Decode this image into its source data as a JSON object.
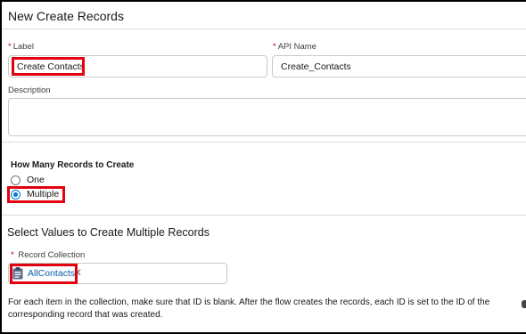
{
  "header": {
    "title": "New Create Records"
  },
  "label_field": {
    "label": "Label",
    "required_mark": "*",
    "value": "Create Contacts"
  },
  "api_field": {
    "label": "API Name",
    "required_mark": "*",
    "value": "Create_Contacts"
  },
  "description_field": {
    "label": "Description",
    "value": ""
  },
  "how_many": {
    "heading": "How Many Records to Create",
    "options": [
      {
        "label": "One",
        "selected": false
      },
      {
        "label": "Multiple",
        "selected": true
      }
    ]
  },
  "select_values": {
    "title": "Select Values to Create Multiple Records",
    "collection_label": "Record Collection",
    "required_mark": "*",
    "collection_value": "AllContacts",
    "clear_glyph": "✕"
  },
  "help_text": "For each item in the collection, make sure that ID is blank. After the flow creates the records, each ID is set to the ID of the corresponding record that was created.",
  "colors": {
    "accent": "#0176d3",
    "highlight": "#e3000f",
    "required": "#ba0517",
    "pill_text": "#0b5cab"
  }
}
